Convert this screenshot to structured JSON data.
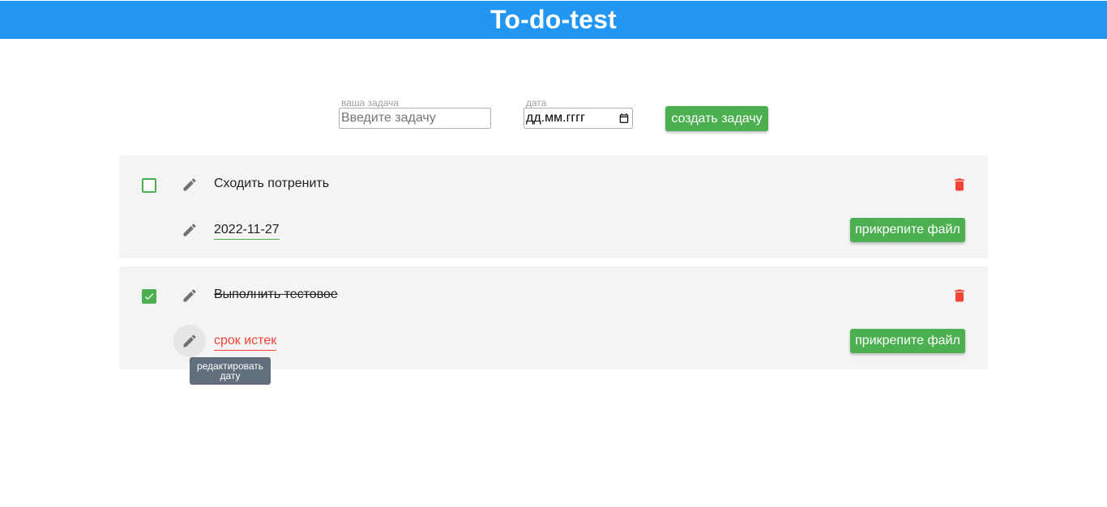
{
  "app": {
    "title": "To-do-test"
  },
  "form": {
    "task_label": "ваша задача",
    "task_placeholder": "Введите задачу",
    "task_value": "",
    "date_label": "дата",
    "date_placeholder": "дд.мм.гггг",
    "create_button": "создать задачу"
  },
  "tasks": [
    {
      "title": "Сходить потренить",
      "completed": false,
      "date_text": "2022-11-27",
      "date_status": "ok",
      "attach_button": "прикрепите файл"
    },
    {
      "title": "Выполнить тестовое",
      "completed": true,
      "date_text": "срок истек",
      "date_status": "expired",
      "attach_button": "прикрепите файл"
    }
  ],
  "tooltip": {
    "text": "редактировать дату"
  },
  "colors": {
    "appbar": "#2196f3",
    "accent_green": "#4caf50",
    "danger_red": "#f44336",
    "card_bg": "#f4f4f4",
    "tooltip_bg": "#616e7b"
  },
  "icons": {
    "edit": "pencil-icon",
    "delete": "trash-icon",
    "calendar": "calendar-icon",
    "check": "check-icon"
  }
}
